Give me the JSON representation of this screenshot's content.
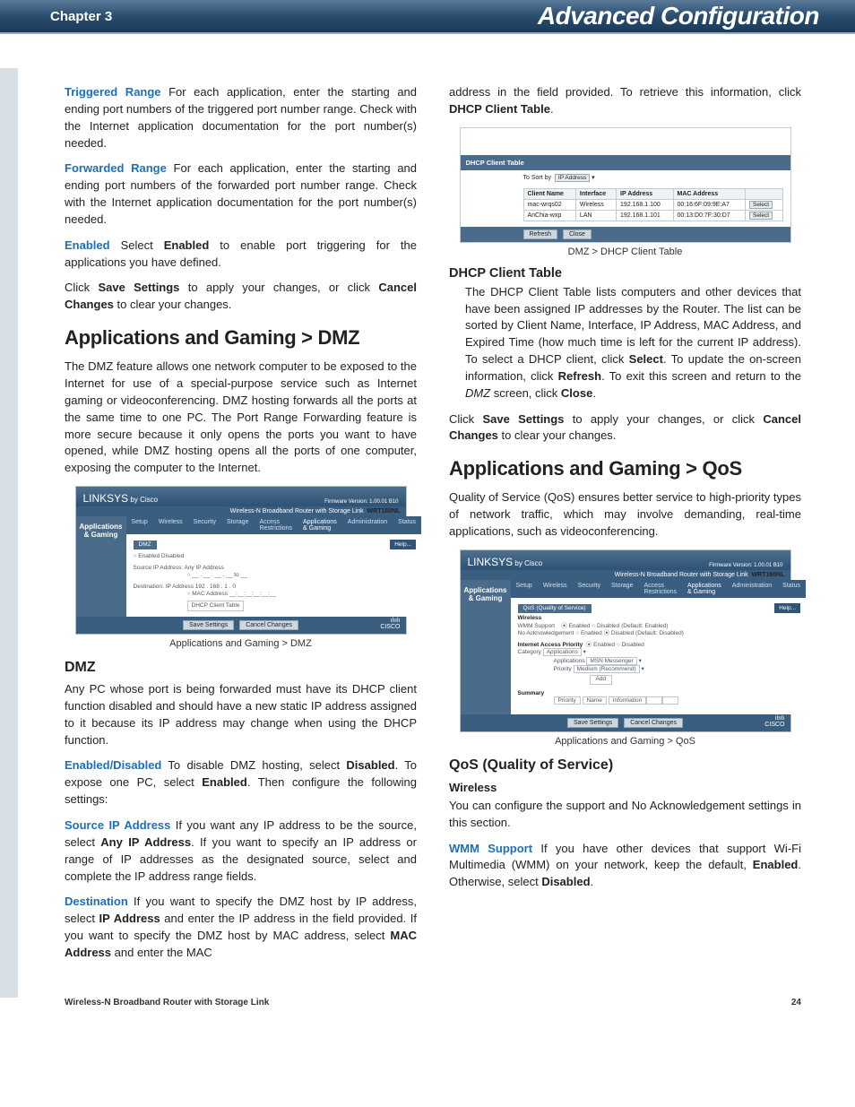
{
  "header": {
    "chapter": "Chapter 3",
    "title": "Advanced Configuration"
  },
  "left": {
    "p1a": "Triggered Range",
    "p1b": "  For each application, enter the starting and ending port numbers of the triggered port number range. Check with the Internet application documentation for the port number(s) needed.",
    "p2a": "Forwarded Range",
    "p2b": "  For each application, enter the starting and ending port numbers of the forwarded port number range. Check with the Internet application documentation for the port number(s) needed.",
    "p3a": "Enabled",
    "p3b": "  Select ",
    "p3c": "Enabled",
    "p3d": " to enable port triggering for the applications you have defined.",
    "p4a": "Click ",
    "p4b": "Save Settings",
    "p4c": " to apply your changes, or click ",
    "p4d": "Cancel Changes",
    "p4e": " to clear your changes.",
    "h2_dmz": "Applications and Gaming > DMZ",
    "p5": "The DMZ feature allows one network computer to be exposed to the Internet for use of a special-purpose service such as Internet gaming or videoconferencing. DMZ hosting forwards all the ports at the same time to one PC. The Port Range Forwarding feature is more secure because it only opens the ports you want to have opened, while DMZ hosting opens all the ports of one computer, exposing the computer to the Internet.",
    "fig1_caption": "Applications and Gaming > DMZ",
    "h3_dmz": "DMZ",
    "p6": "Any PC whose port is being forwarded must have its DHCP client function disabled and should have a new static IP address assigned to it because its IP address may change when using the DHCP function.",
    "p7a": "Enabled/Disabled",
    "p7b": " To disable DMZ hosting, select ",
    "p7c": "Disabled",
    "p7d": ". To expose one PC, select ",
    "p7e": "Enabled",
    "p7f": ". Then configure the following settings:",
    "p8a": "Source IP Address",
    "p8b": "  If you want any IP address to be the source, select ",
    "p8c": "Any IP Address",
    "p8d": ". If you want to specify an IP address or range of IP addresses as the designated source, select and complete the IP address range fields.",
    "p9a": "Destination",
    "p9b": "  If you want to specify the DMZ host by IP address, select ",
    "p9c": "IP Address",
    "p9d": " and enter the IP address in the field provided. If you want to specify the DMZ host by MAC address, select ",
    "p9e": "MAC Address",
    "p9f": " and enter the MAC"
  },
  "right": {
    "p1a": "address in the field provided. To retrieve this information, click ",
    "p1b": "DHCP Client Table",
    "p1c": ".",
    "fig2_caption": "DMZ > DHCP Client Table",
    "h4_dhcp": "DHCP Client Table",
    "p2a": "The DHCP Client Table lists computers and other devices that have been assigned IP addresses by the Router. The list can be sorted by Client Name, Interface, IP Address, MAC Address, and Expired Time (how much time is left for the current IP address). To select a DHCP client, click ",
    "p2b": "Select",
    "p2c": ". To update the on-screen information, click ",
    "p2d": "Refresh",
    "p2e": ". To exit this screen and return to the ",
    "p2f": "DMZ",
    "p2g": " screen, click ",
    "p2h": "Close",
    "p2i": ".",
    "p3a": "Click ",
    "p3b": "Save Settings",
    "p3c": " to apply your changes, or click ",
    "p3d": "Cancel Changes",
    "p3e": " to clear your changes.",
    "h2_qos": "Applications and Gaming > QoS",
    "p4": "Quality of Service (QoS) ensures better service to high-priority types of network traffic, which may involve demanding, real-time applications, such as videoconferencing.",
    "fig3_caption": "Applications and Gaming > QoS",
    "h3_qos": "QoS (Quality of Service)",
    "h5_wireless": "Wireless",
    "p5": "You can configure the support and No Acknowledgement settings in this section.",
    "p6a": "WMM Support",
    "p6b": "  If you have other devices that support Wi-Fi Multimedia (WMM) on your network, keep the default, ",
    "p6c": "Enabled",
    "p6d": ". Otherwise, select ",
    "p6e": "Disabled",
    "p6f": "."
  },
  "shot_common": {
    "brand": "LINKSYS",
    "brand_by": " by Cisco",
    "fw": "Firmware Version: 1.00.01 B10",
    "subtitle": "Wireless-N Broadband Router with Storage Link",
    "model": "WRT160NL",
    "side": "Applications & Gaming",
    "tabs": [
      "Setup",
      "Wireless",
      "Security",
      "Storage",
      "Access Restrictions",
      "Applications & Gaming",
      "Administration",
      "Status"
    ],
    "save": "Save Settings",
    "cancel": "Cancel Changes",
    "help": "Help...",
    "cisco1": "ılıılı",
    "cisco2": "CISCO"
  },
  "shot_dmz": {
    "section": "DMZ",
    "row1": "Enabled   Disabled",
    "row2": "Source IP Address:   Any IP Address",
    "row3": "Destination:   IP Address 192 . 168 . 1 . 0",
    "row4": "MAC Address",
    "row5": "DHCP Client Table"
  },
  "shot_dhcp": {
    "title": "DHCP Client Table",
    "sortby": "To Sort by",
    "sortval": "IP Address",
    "headers": [
      "Client Name",
      "Interface",
      "IP Address",
      "MAC Address",
      ""
    ],
    "rows": [
      [
        "mac-wrqs02",
        "Wireless",
        "192.168.1.100",
        "00:16:6F:09:9E:A7",
        "Select"
      ],
      [
        "AnChia-wxp",
        "LAN",
        "192.168.1.101",
        "00:13:D0:7F:30:D7",
        "Select"
      ]
    ],
    "refresh": "Refresh",
    "close": "Close"
  },
  "shot_qos": {
    "section1": "QoS (Quality of Service)",
    "wireless": "Wireless",
    "wmm": "WMM Support",
    "noack": "No Acknowledgement",
    "en": "Enabled",
    "dis": "Disabled",
    "def1": "(Default: Enabled)",
    "def2": "(Default: Disabled)",
    "iap": "Internet Access Priority",
    "cat": "Category",
    "catval": "Applications",
    "apps": "Applications",
    "appsval": "MSN Messenger",
    "prio": "Priority",
    "prival": "Medium (Recommend)",
    "add": "Add",
    "summary": "Summary",
    "sh": [
      "Priority",
      "Name",
      "Information",
      "",
      ""
    ]
  },
  "footer": {
    "left": "Wireless-N Broadband Router with Storage Link",
    "right": "24"
  }
}
